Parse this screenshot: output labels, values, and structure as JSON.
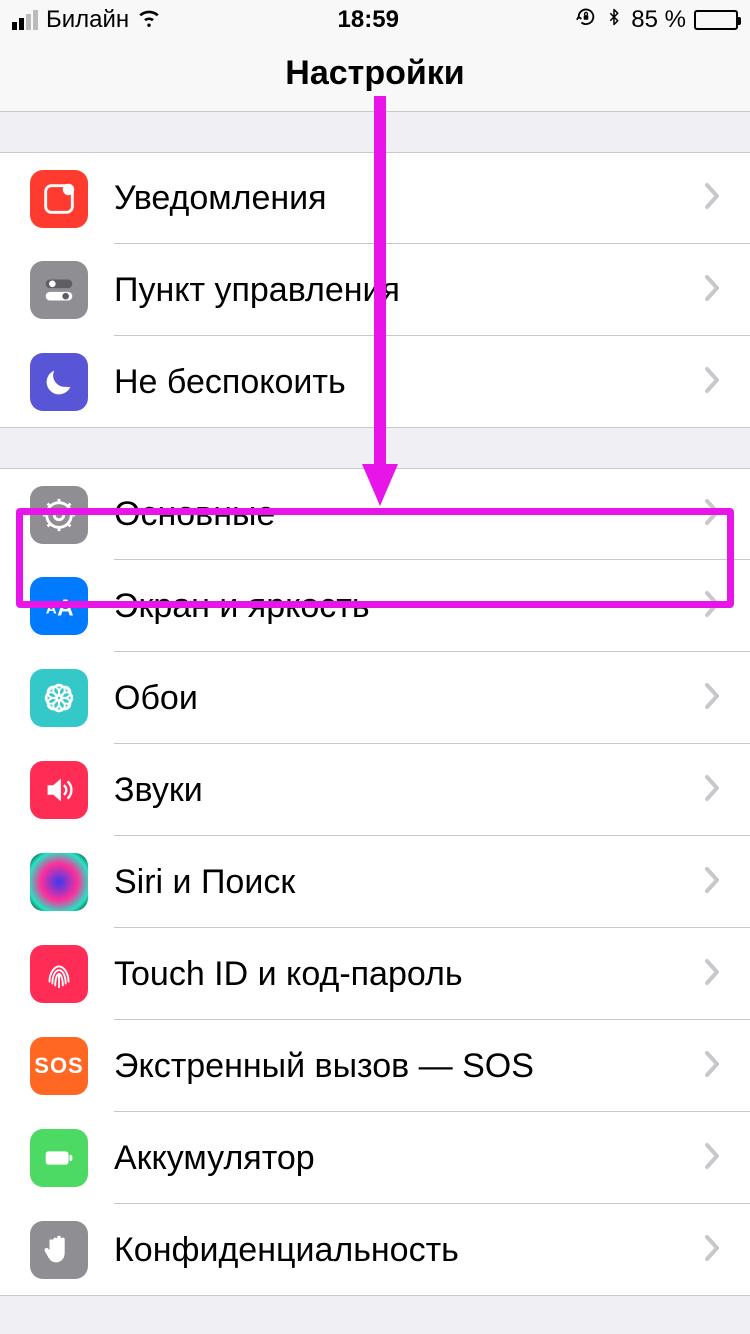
{
  "statusbar": {
    "carrier": "Билайн",
    "time": "18:59",
    "battery_percent": "85 %"
  },
  "nav": {
    "title": "Настройки"
  },
  "group1": {
    "notifications": "Уведомления",
    "control_center": "Пункт управления",
    "dnd": "Не беспокоить"
  },
  "group2": {
    "general": "Основные",
    "display": "Экран и яркость",
    "wallpaper": "Обои",
    "sounds": "Звуки",
    "siri": "Siri и Поиск",
    "touchid": "Touch ID и код-пароль",
    "sos_label": "Экстренный вызов — SOS",
    "sos_icon_text": "SOS",
    "battery": "Аккумулятор",
    "privacy": "Конфиденциальность"
  },
  "annotation": {
    "highlight_target": "general-row"
  }
}
